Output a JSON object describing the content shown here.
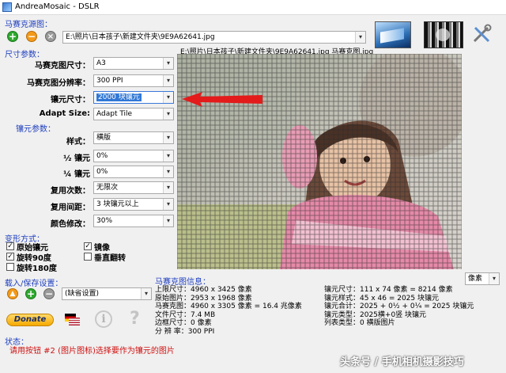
{
  "window": {
    "title": "AndreaMosaic - DSLR"
  },
  "source": {
    "section_title": "马赛克源图：",
    "path": "E:\\照片\\日本孩子\\新建文件夹\\9E9A62641.jpg"
  },
  "image_caption": "E:\\照片\\日本孩子\\新建文件夹\\9E9A62641.jpg 马赛克图.jpg",
  "size_params": {
    "section_title": "尺寸参数：",
    "rows": [
      {
        "label": "马赛克图尺寸：",
        "value": "A3"
      },
      {
        "label": "马赛克图分辨率：",
        "value": "300 PPI"
      },
      {
        "label": "镶元尺寸：",
        "value": "2000 块镶元"
      },
      {
        "label": "Adapt Size:",
        "value": "Adapt Tile"
      }
    ]
  },
  "tile_params": {
    "section_title": "镶元参数：",
    "rows": [
      {
        "label": "样式：",
        "value": "横版"
      },
      {
        "label": "½ 镶元",
        "value": "0%"
      },
      {
        "label": "¼ 镶元",
        "value": "0%"
      },
      {
        "label": "复用次数：",
        "value": "无限次"
      },
      {
        "label": "复用间距：",
        "value": "3 块镶元以上"
      },
      {
        "label": "颜色修改：",
        "value": "30%"
      }
    ]
  },
  "transform": {
    "section_title": "变形方式：",
    "options": [
      {
        "label": "原始镶元",
        "checked": true
      },
      {
        "label": "镜像",
        "checked": true
      },
      {
        "label": "旋转90度",
        "checked": true
      },
      {
        "label": "垂直翻转",
        "checked": false
      },
      {
        "label": "旋转180度",
        "checked": false
      }
    ]
  },
  "load_save": {
    "section_title": "载入/保存设置：",
    "preset": "(缺省设置)"
  },
  "donate_label": "Donate",
  "unit_select": "像素",
  "mosaic_info": {
    "section_title": "马赛克图信息：",
    "left": [
      "上限尺寸：4960 x 3425 像素",
      "原始图片：2953 x 1968 像素",
      "马赛克图：4960 x 3305 像素 = 16.4 兆像素",
      "文件尺寸：7.4 MB",
      "边框尺寸：0 像素",
      "分 辨 率：300 PPI"
    ],
    "right": [
      "镶元尺寸：111 x 74 像素 = 8214 像素",
      "镶元样式：45 x 46 = 2025 块镶元",
      "镶元合计：2025 + 0½ + 0¼ = 2025 块镶元",
      "镶元类型：2025横+0竖 块镶元",
      "列表类型：0 横版图片"
    ]
  },
  "status": {
    "title": "状态：",
    "message": "请用按钮 #2 (图片图标)选择要作为镶元的图片"
  },
  "watermark": "头条号 / 手机相机摄影技巧"
}
